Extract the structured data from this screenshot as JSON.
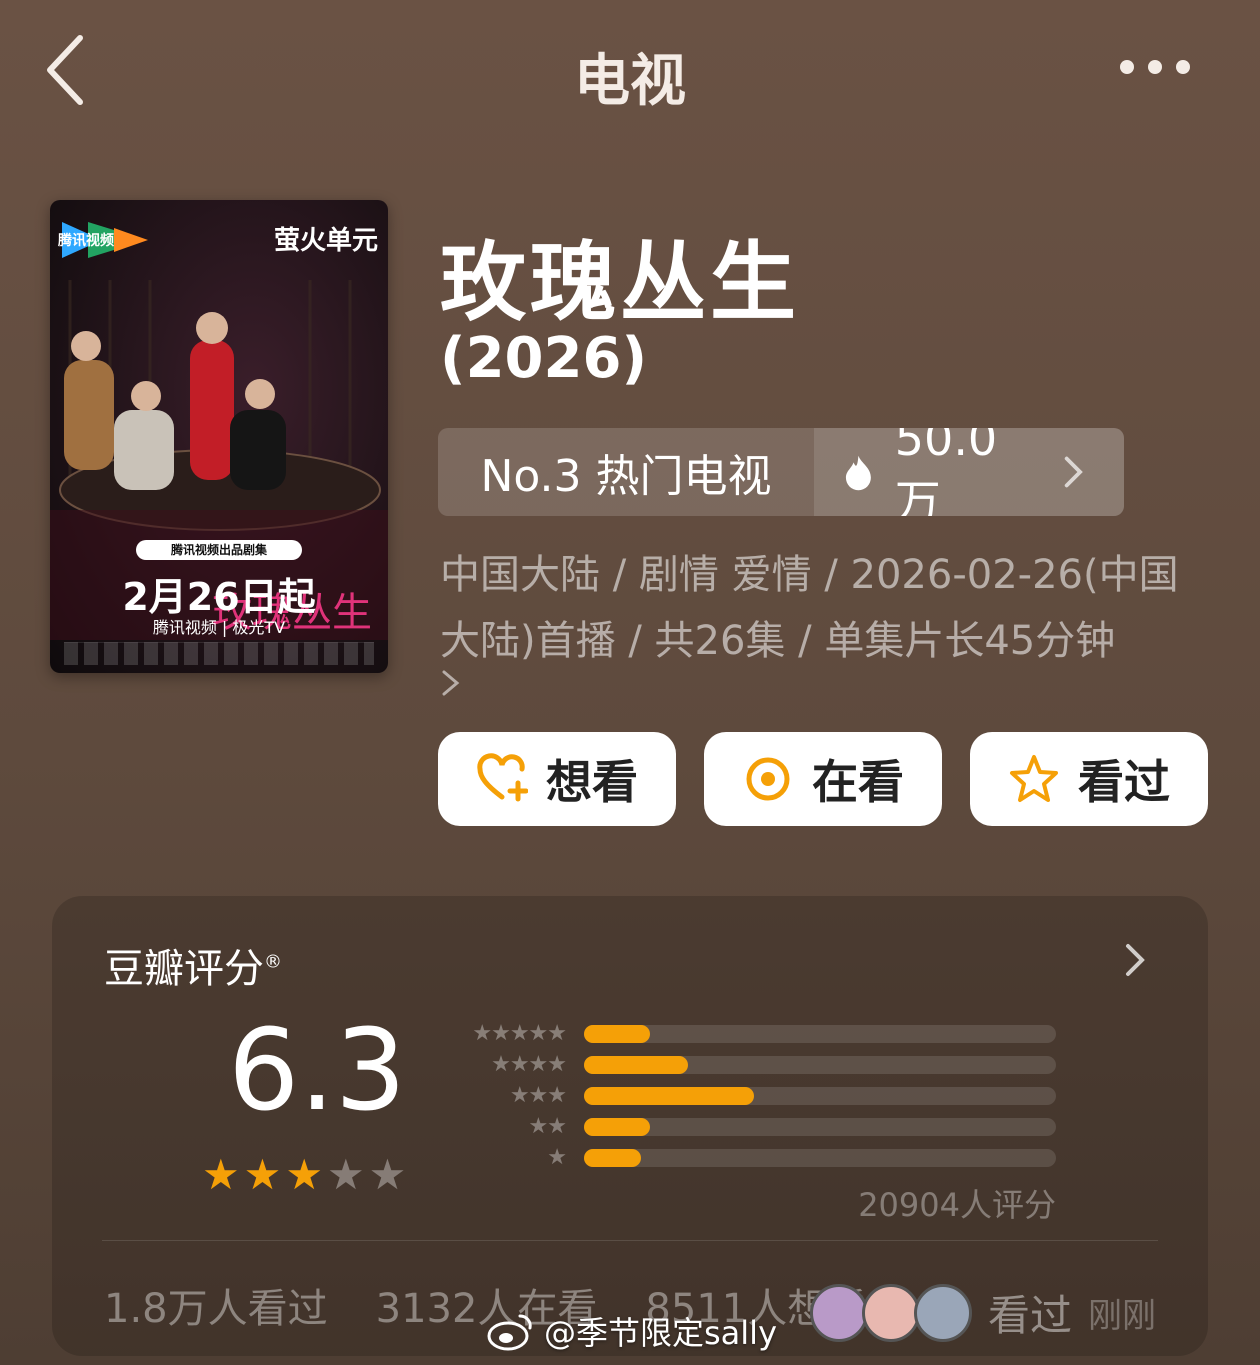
{
  "header": {
    "title": "电视"
  },
  "poster": {
    "platform_logo": "腾讯视频",
    "unit_label": "萤火单元",
    "poster_title": "玫瑰丛生",
    "banner": "腾讯视频出品剧集",
    "date": "2月26日起",
    "platforms": "腾讯视频 | 极光TV"
  },
  "show": {
    "title": "玫瑰丛生",
    "year": "(2026)"
  },
  "rank": {
    "label": "No.3 热门电视",
    "heat": "50.0万"
  },
  "meta": {
    "text": "中国大陆 / 剧情 爱情 / 2026-02-26(中国大陆)首播 / 共26集 / 单集片长45分钟"
  },
  "actions": {
    "want": "想看",
    "watching": "在看",
    "watched": "看过"
  },
  "rating": {
    "heading": "豆瓣评分",
    "registered": "®",
    "score": "6.3",
    "stars_filled": 3,
    "stars_total": 5,
    "distribution": [
      {
        "stars": "★★★★★",
        "percent": 14
      },
      {
        "stars": "★★★★",
        "percent": 22
      },
      {
        "stars": "★★★",
        "percent": 36
      },
      {
        "stars": "★★",
        "percent": 14
      },
      {
        "stars": "★",
        "percent": 12
      }
    ],
    "count": "20904人评分",
    "watched": "1.8万人看过",
    "watching": "3132人在看",
    "want": "8511人想看",
    "recent_action": "看过",
    "recent_time": "刚刚"
  },
  "watermark": {
    "text": "@季节限定sally"
  },
  "colors": {
    "accent": "#f5a007",
    "background": "#5e4a3d",
    "poster_title": "#e0337a"
  }
}
